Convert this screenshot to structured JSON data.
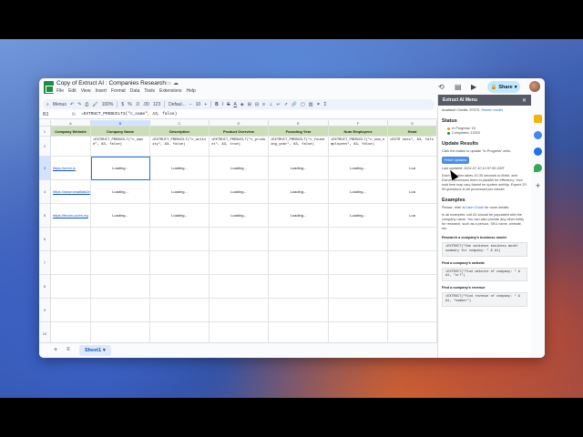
{
  "doc": {
    "title": "Copy of Extruct AI : Companies Research",
    "menu": [
      "File",
      "Edit",
      "View",
      "Insert",
      "Format",
      "Data",
      "Tools",
      "Extensions",
      "Help"
    ],
    "share_label": "Share"
  },
  "toolbar": {
    "menus_label": "Menus",
    "zoom": "100%",
    "currency": "$",
    "percent": "%",
    "decimal_dec": ".0",
    "decimal_inc": ".00",
    "number_format": "123",
    "font": "Defaul...",
    "font_size": "10"
  },
  "formula_bar": {
    "cell_ref": "B3",
    "fx": "fx",
    "formula": "=EXTRUCT_PREBUILT2(\"c_name\", A3, false)"
  },
  "grid": {
    "columns": [
      "A",
      "B",
      "C",
      "D",
      "E",
      "F",
      "G"
    ],
    "rows": [
      "1",
      "2",
      "3",
      "4",
      "5",
      "6",
      "7",
      "8",
      "9",
      "10"
    ],
    "headers": [
      "Company Website",
      "Company Name",
      "Description",
      "Product Overview",
      "Founding Year",
      "Num Employees",
      "Head"
    ],
    "formulas": [
      "",
      "=EXTRUCT_PREBUILT(\"c_name\", A3, false)",
      "=EXTRUCT_PREBUILT(\"c_activity\", A3, false)",
      "=EXTRUCT_PREBUILT(\"c_product\", A3, true)",
      "=EXTRUCT_PREBUILT(\"c_founding_year\", A3, false)",
      "=EXTRUCT_PREBUILT(\"c_num_employees\", A3, false)",
      "=EXTR ness\", A3, fals"
    ],
    "urls": [
      "https://omni.io",
      "https://www.smalltalk2me.com",
      "https://fmom.co/en-eg"
    ],
    "loading": "Loading...",
    "loading_short": "Loa"
  },
  "sheet_tabs": {
    "add": "+",
    "list": "≡",
    "active": "Sheet1"
  },
  "panel": {
    "title": "Extruct AI Menu",
    "credits_prefix": "Available Credits: 87070.",
    "credits_link": "Renew credits",
    "status_heading": "Status",
    "in_progress": "In Progress: 16",
    "completed": "Completed: 13220",
    "update_heading": "Update Results",
    "update_hint": "Click the button to update \"In Progress\" cells.",
    "button": "Fetch Updates",
    "last_updated": "Last updated: 2024-07-10 12:57:56 GMT",
    "info": "Each question takes 10-30 seconds to finish, and Extruct processes them in parallel for efficiency. Your wait time may vary based on system activity. Expect 20-50 questions to be processed per minute.",
    "examples_heading": "Examples",
    "examples_intro_prefix": "Please, refer to",
    "examples_intro_link": "User Guide",
    "examples_intro_suffix": "for more details.",
    "examples_desc": "In all examples, cell A1 should be populated with the company name. You can also provide any other entity for research, such as a person, SKU name, website, etc.",
    "ex1_title": "Research a company's business model",
    "ex1_code": "=EXTRUCT(\"One sentence business model summary for company: \" & A1)",
    "ex2_title": "Find a company's website",
    "ex2_code": "=EXTRUCT(\"Find website of company: \" & A1, \"url\")",
    "ex3_title": "Find a company's revenue",
    "ex3_code": "=EXTRUCT(\"Find revenue of company: \" & A1, \"number\")"
  },
  "colors": {
    "header_green": "#c9dfb5",
    "link_blue": "#1155cc",
    "selection_blue": "#1a73e8",
    "panel_header": "#555a66",
    "progress_orange": "#f29900",
    "completed_green": "#1e8e3e"
  }
}
